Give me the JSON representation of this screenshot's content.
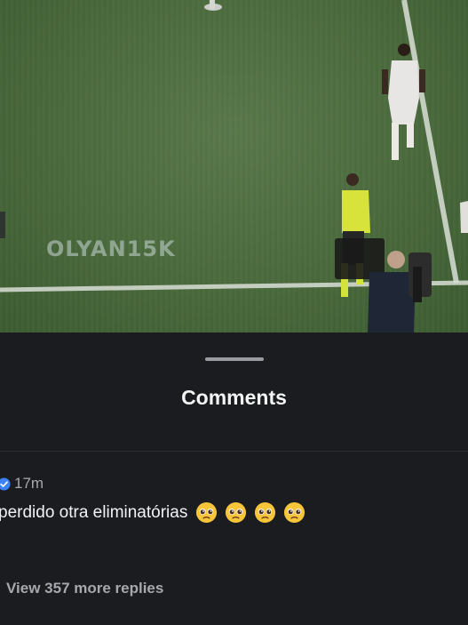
{
  "video": {
    "watermark": "OLYAN15K"
  },
  "comments_sheet": {
    "title": "Comments",
    "comment": {
      "time": "17m",
      "text": "perdido otra eliminatórias",
      "emojis": [
        "pleading-face-icon",
        "pleading-face-icon",
        "pleading-face-icon",
        "pleading-face-icon"
      ],
      "verified": true,
      "view_replies_label": "View 357 more replies"
    }
  },
  "colors": {
    "background": "#1b1c20",
    "pitch": "#4a6a3c",
    "verified_badge": "#3b82f6",
    "secondary_text": "#a7a8ad",
    "primary_text": "#f2f2f4"
  }
}
